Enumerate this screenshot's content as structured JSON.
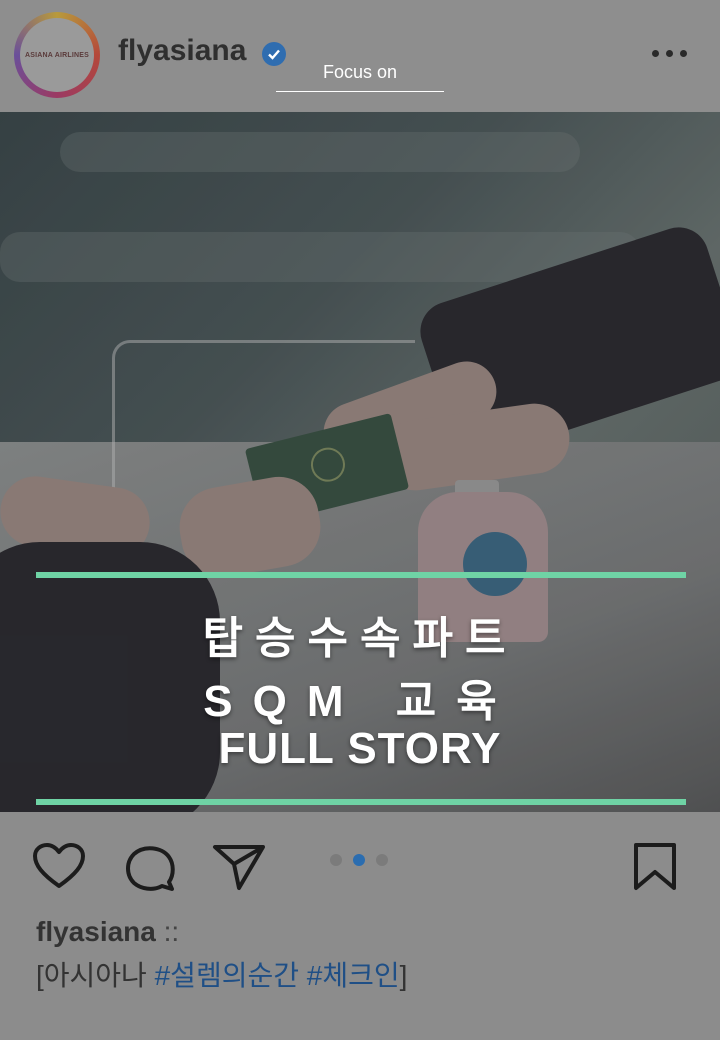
{
  "header": {
    "avatar_text": "ASIANA AIRLINES",
    "username": "flyasiana",
    "verified_icon": "verified-badge-icon",
    "focus_label": "Focus on",
    "more_icon": "more-options-icon"
  },
  "post": {
    "title_lines": [
      "탑승수속파트",
      "SQM 교육",
      "FULL STORY"
    ],
    "accent_color": "#6fd3a5"
  },
  "actions": {
    "like_icon": "heart-icon",
    "comment_icon": "comment-icon",
    "share_icon": "share-icon",
    "save_icon": "bookmark-icon",
    "carousel": {
      "count": 3,
      "active_index": 1
    }
  },
  "caption": {
    "username": "flyasiana",
    "separator": "::",
    "open_bracket": "[",
    "prefix": "아시아나",
    "hashtags": [
      "#설렘의순간",
      "#체크인"
    ],
    "close_bracket": "]"
  }
}
